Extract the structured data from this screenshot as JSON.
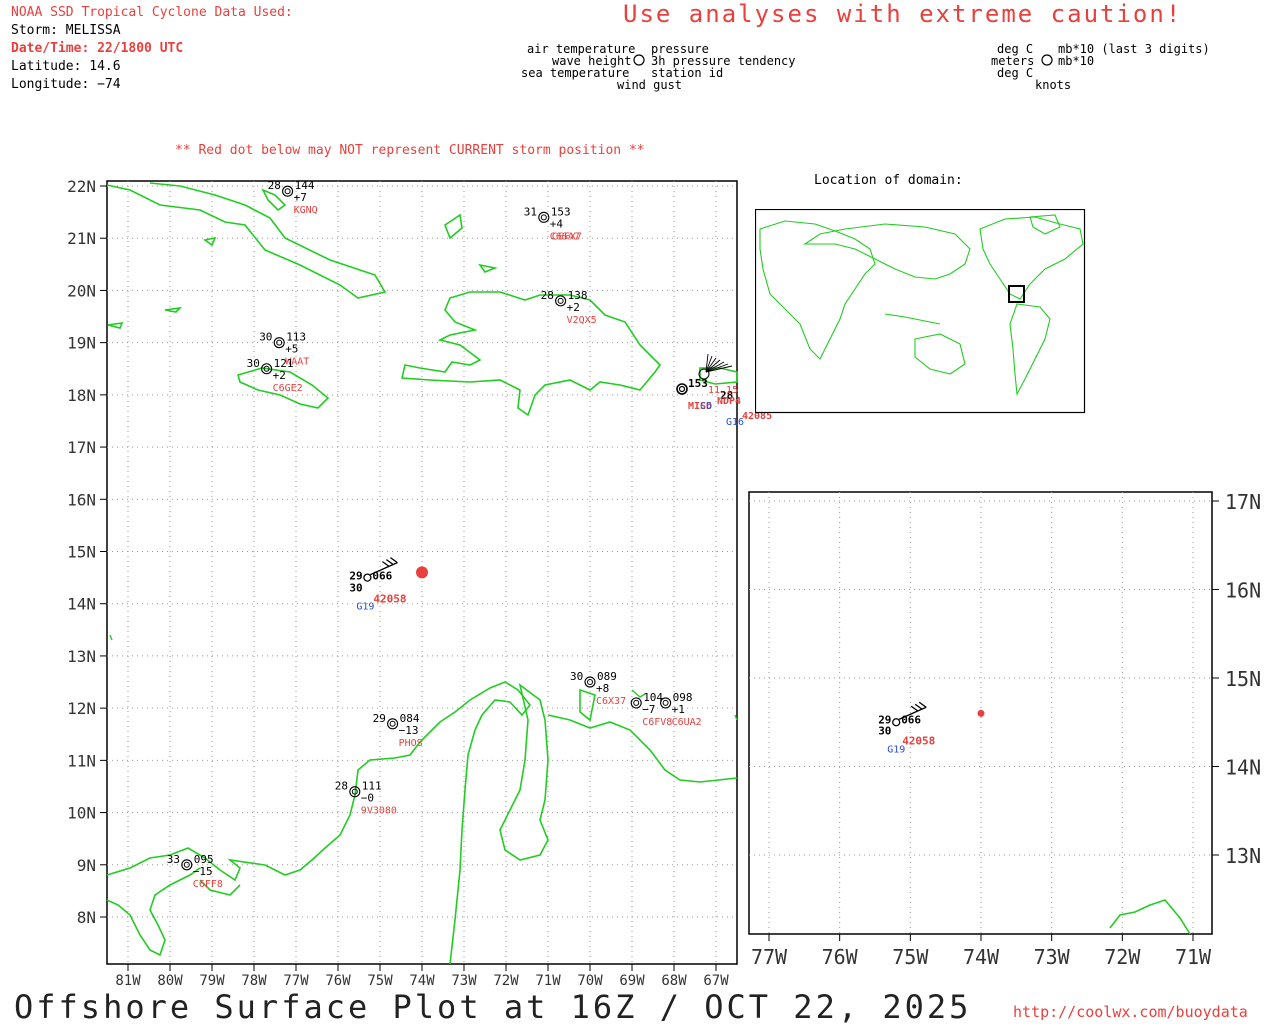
{
  "header": {
    "source_line": "NOAA SSD Tropical Cyclone Data Used:",
    "storm": "Storm: MELISSA",
    "datetime": "Date/Time: 22/1800 UTC",
    "latitude": "Latitude: 14.6",
    "longitude": "Longitude: −74",
    "caution": "Use analyses with extreme caution!",
    "red_dot_note": "** Red dot below may NOT represent CURRENT storm position **"
  },
  "legend": {
    "left_col": [
      "air temperature",
      "wave height",
      "sea temperature"
    ],
    "right_col": [
      "pressure",
      "3h pressure tendency",
      "station id"
    ],
    "bottom": "wind gust",
    "units_left": [
      "deg C",
      "meters",
      "deg C"
    ],
    "units_right": [
      "mb*10 (last 3 digits)",
      "mb*10"
    ],
    "units_bottom": "knots"
  },
  "inset": {
    "title": "Location of domain:"
  },
  "main_map": {
    "lat_labels": [
      "22N",
      "21N",
      "20N",
      "19N",
      "18N",
      "17N",
      "16N",
      "15N",
      "14N",
      "13N",
      "12N",
      "11N",
      "10N",
      "9N",
      "8N"
    ],
    "lon_labels": [
      "81W",
      "80W",
      "79W",
      "78W",
      "77W",
      "76W",
      "75W",
      "74W",
      "73W",
      "72W",
      "71W",
      "70W",
      "69W",
      "68W",
      "67W"
    ],
    "stations": [
      {
        "id": "KGNQ",
        "t": "28",
        "p": "144",
        "tend": "+7",
        "lon": -77.2,
        "lat": 21.9
      },
      {
        "id": "C6SA7",
        "t": "31",
        "p": "153",
        "tend": "+4",
        "lon": -71.1,
        "lat": 21.4,
        "overlap": "C6FX7"
      },
      {
        "id": "V2QX5",
        "t": "28",
        "p": "138",
        "tend": "+2",
        "lon": -70.7,
        "lat": 19.8
      },
      {
        "id": "WAAT",
        "t": "30",
        "p": "113",
        "tend": "+5",
        "lon": -77.4,
        "lat": 19.0
      },
      {
        "id": "C6GE2",
        "t": "30",
        "p": "121",
        "tend": "+2",
        "lon": -77.7,
        "lat": 18.5
      },
      {
        "id": "42058",
        "t": "29",
        "p": "066",
        "sst": "30",
        "gust": "G19",
        "lon": -75.3,
        "lat": 14.5,
        "buoy": true
      },
      {
        "id": "C6X37",
        "t": "30",
        "p": "089",
        "tend": "+8",
        "lon": -70.0,
        "lat": 12.5
      },
      {
        "id": "C6FV8",
        "t": "",
        "p": "104",
        "tend": "−7",
        "lon": -68.9,
        "lat": 12.1
      },
      {
        "id": "C6UA2",
        "t": "",
        "p": "098",
        "tend": "+1",
        "lon": -68.2,
        "lat": 12.1
      },
      {
        "id": "PHOS",
        "t": "29",
        "p": "084",
        "tend": "−13",
        "lon": -74.7,
        "lat": 11.7
      },
      {
        "id": "9V3080",
        "t": "28",
        "p": "111",
        "tend": "−0",
        "lon": -75.6,
        "lat": 10.4
      },
      {
        "id": "C6FF8",
        "t": "33",
        "p": "095",
        "tend": "−15",
        "lon": -79.6,
        "lat": 9.0
      }
    ],
    "cluster_labels": {
      "p": "153",
      "t": "28",
      "ids": [
        "MISD",
        "NDP4",
        "42085"
      ],
      "gust": "G16",
      "g2": "C6",
      "tend": "11.15"
    },
    "storm_dot": {
      "lon": -74.0,
      "lat": 14.6
    }
  },
  "zoom_map": {
    "lat_labels": [
      "17N",
      "16N",
      "15N",
      "14N",
      "13N"
    ],
    "lon_labels": [
      "77W",
      "76W",
      "75W",
      "74W",
      "73W",
      "72W",
      "71W"
    ],
    "station": {
      "id": "42058",
      "t": "29",
      "p": "066",
      "sst": "30",
      "gust": "G19"
    }
  },
  "footer": {
    "title": "Offshore Surface Plot at 16Z / OCT 22, 2025",
    "url": "http://coolwx.com/buoydata"
  },
  "colors": {
    "land": "#22cc22",
    "accent": "#e8413d",
    "gust": "#2b4bd8",
    "grid": "#999999"
  }
}
